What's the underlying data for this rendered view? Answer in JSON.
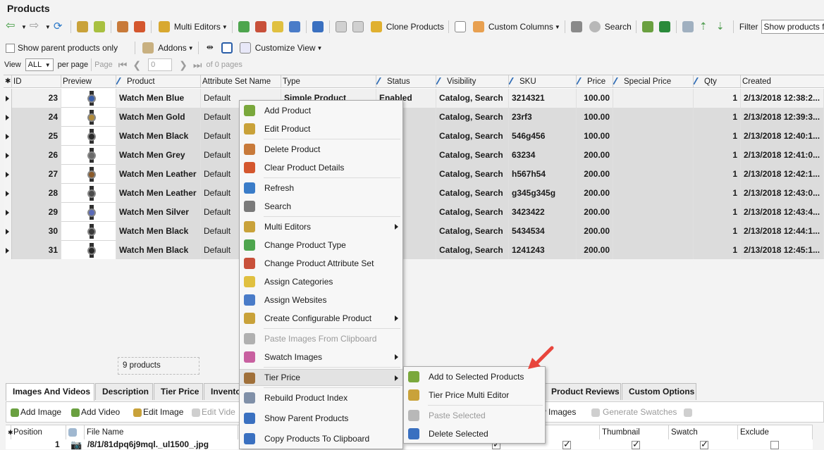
{
  "title": "Products",
  "toolbar": {
    "multi_editors": "Multi Editors",
    "clone_products": "Clone Products",
    "custom_columns": "Custom Columns",
    "search": "Search",
    "filter_label": "Filter",
    "filter_value": "Show products from sele"
  },
  "toolbar2": {
    "show_parent": "Show parent products only",
    "addons": "Addons",
    "customize_view": "Customize View"
  },
  "pager": {
    "view_label": "View",
    "view_value": "ALL",
    "per_page": "per page",
    "page_label": "Page",
    "page_value": "0",
    "of_pages": "of 0 pages"
  },
  "grid": {
    "columns": [
      "ID",
      "Preview",
      "Product",
      "Attribute Set Name",
      "Type",
      "Status",
      "Visibility",
      "SKU",
      "Price",
      "Special Price",
      "Qty",
      "Created"
    ],
    "rows": [
      {
        "id": "23",
        "product": "Watch Men Blue",
        "attr": "Default",
        "type": "Simple Product",
        "status": "Enabled",
        "visibility": "Catalog, Search",
        "sku": "3214321",
        "price": "100.00",
        "qty": "1",
        "created": "2/13/2018 12:38:2..."
      },
      {
        "id": "24",
        "product": "Watch Men Gold",
        "attr": "Default",
        "type": "",
        "status": "d",
        "visibility": "Catalog, Search",
        "sku": "23rf3",
        "price": "100.00",
        "qty": "1",
        "created": "2/13/2018 12:39:3..."
      },
      {
        "id": "25",
        "product": "Watch Men Black",
        "attr": "Default",
        "type": "",
        "status": "d",
        "visibility": "Catalog, Search",
        "sku": "546g456",
        "price": "100.00",
        "qty": "1",
        "created": "2/13/2018 12:40:1..."
      },
      {
        "id": "26",
        "product": "Watch Men Grey",
        "attr": "Default",
        "type": "",
        "status": "d",
        "visibility": "Catalog, Search",
        "sku": "63234",
        "price": "200.00",
        "qty": "1",
        "created": "2/13/2018 12:41:0..."
      },
      {
        "id": "27",
        "product": "Watch Men Leather",
        "attr": "Default",
        "type": "",
        "status": "d",
        "visibility": "Catalog, Search",
        "sku": "h567h54",
        "price": "200.00",
        "qty": "1",
        "created": "2/13/2018 12:42:1..."
      },
      {
        "id": "28",
        "product": "Watch Men Leather",
        "attr": "Default",
        "type": "",
        "status": "d",
        "visibility": "Catalog, Search",
        "sku": "g345g345g",
        "price": "200.00",
        "qty": "1",
        "created": "2/13/2018 12:43:0..."
      },
      {
        "id": "29",
        "product": "Watch Men Silver",
        "attr": "Default",
        "type": "",
        "status": "d",
        "visibility": "Catalog, Search",
        "sku": "3423422",
        "price": "200.00",
        "qty": "1",
        "created": "2/13/2018 12:43:4..."
      },
      {
        "id": "30",
        "product": "Watch Men Black",
        "attr": "Default",
        "type": "",
        "status": "d",
        "visibility": "Catalog, Search",
        "sku": "5434534",
        "price": "200.00",
        "qty": "1",
        "created": "2/13/2018 12:44:1..."
      },
      {
        "id": "31",
        "product": "Watch Men Black",
        "attr": "Default",
        "type": "",
        "status": "d",
        "visibility": "Catalog, Search",
        "sku": "1241243",
        "price": "200.00",
        "qty": "1",
        "created": "2/13/2018 12:45:1..."
      }
    ]
  },
  "count_text": "9 products",
  "tabs": [
    "Images And Videos",
    "Description",
    "Tier Price",
    "Invento",
    "Product Reviews",
    "Custom Options"
  ],
  "bottom_toolbar": {
    "add_image": "Add Image",
    "add_video": "Add Video",
    "edit_image": "Edit Image",
    "edit_video": "Edit Vide",
    "view_images": "w Images",
    "generate_swatches": "Generate Swatches"
  },
  "bottom_grid": {
    "columns": [
      "Position",
      "File Name",
      "ll",
      "Thumbnail",
      "Swatch",
      "Exclude"
    ],
    "row": {
      "position": "1",
      "file": "/8/1/81dpq6j9mql._ul1500_.jpg"
    }
  },
  "context_menu": {
    "items": [
      {
        "label": "Add Product",
        "icon": "add-product-icon",
        "color": "#7aa83c"
      },
      {
        "label": "Edit Product",
        "icon": "edit-product-icon",
        "color": "#c9a23a"
      },
      {
        "label": "Delete Product",
        "icon": "delete-product-icon",
        "color": "#c87a3a"
      },
      {
        "label": "Clear Product Details",
        "icon": "clear-details-icon",
        "color": "#d4572e"
      },
      {
        "label": "Refresh",
        "icon": "refresh-icon",
        "color": "#3a7cc8"
      },
      {
        "label": "Search",
        "icon": "search-icon",
        "color": "#7a7a7a"
      },
      {
        "label": "Multi Editors",
        "icon": "multi-editors-icon",
        "color": "#c9a23a"
      },
      {
        "label": "Change Product Type",
        "icon": "change-type-icon",
        "color": "#4ea54e"
      },
      {
        "label": "Change Product Attribute Set",
        "icon": "attribute-set-icon",
        "color": "#c8503a"
      },
      {
        "label": "Assign Categories",
        "icon": "categories-icon",
        "color": "#e0c040"
      },
      {
        "label": "Assign Websites",
        "icon": "websites-icon",
        "color": "#4a7cc8"
      },
      {
        "label": "Create Configurable Product",
        "icon": "configurable-icon",
        "color": "#c9a23a"
      },
      {
        "label": "Paste Images From Clipboard",
        "icon": "paste-images-icon",
        "color": "#b0b0b0"
      },
      {
        "label": "Swatch Images",
        "icon": "swatch-icon",
        "color": "#c860a0"
      },
      {
        "label": "Tier Price",
        "icon": "tier-price-icon",
        "color": "#a0703a"
      },
      {
        "label": "Rebuild Product Index",
        "icon": "rebuild-index-icon",
        "color": "#8090a8"
      },
      {
        "label": "Show Parent Products",
        "icon": "parent-products-icon",
        "color": "#3a70c0"
      },
      {
        "label": "Copy Products To Clipboard",
        "icon": "copy-clipboard-icon",
        "color": "#3a70c0"
      }
    ]
  },
  "submenu": {
    "items": [
      {
        "label": "Add to Selected Products",
        "icon": "add-tier-icon",
        "color": "#7aa83c"
      },
      {
        "label": "Tier Price Multi Editor",
        "icon": "tier-editor-icon",
        "color": "#c9a23a"
      },
      {
        "label": "Paste Selected",
        "icon": "paste-selected-icon",
        "color": "#b8b8b8"
      },
      {
        "label": "Delete Selected",
        "icon": "delete-selected-icon",
        "color": "#3a70c0"
      }
    ]
  }
}
